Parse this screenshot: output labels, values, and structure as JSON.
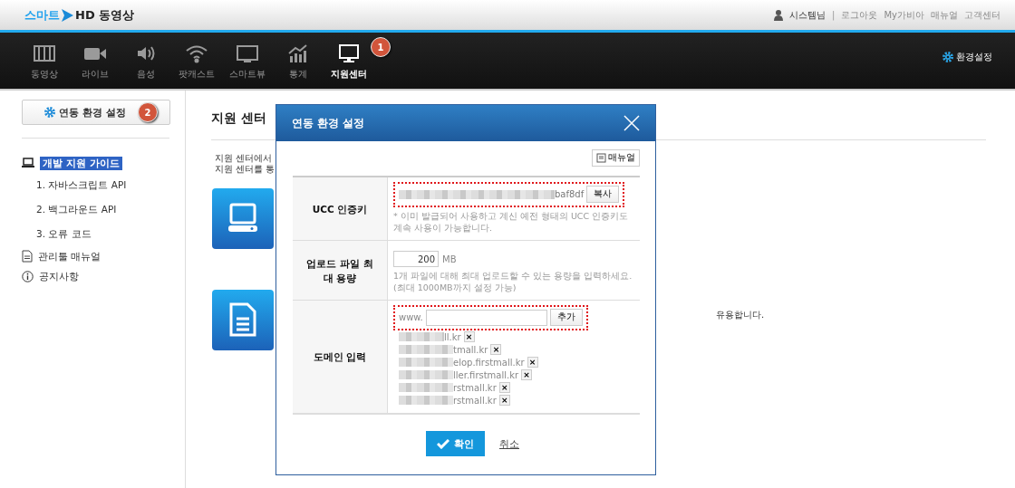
{
  "logo": {
    "part_1": "스마트",
    "part_2": "HD 동영상"
  },
  "top_links": {
    "user": "시스템님",
    "separator": "|",
    "links": [
      "로그아웃",
      "My가비아",
      "매뉴얼",
      "고객센터"
    ]
  },
  "nav": {
    "items": [
      {
        "label": "동영상",
        "selected": false
      },
      {
        "label": "라이브",
        "selected": false
      },
      {
        "label": "음성",
        "selected": false
      },
      {
        "label": "팟캐스트",
        "selected": false
      },
      {
        "label": "스마트뷰",
        "selected": false
      },
      {
        "label": "통계",
        "selected": false
      },
      {
        "label": "지원센터",
        "selected": true,
        "badge": "1"
      }
    ],
    "settings": "환경설정"
  },
  "sidebar": {
    "button": "연동 환경 설정",
    "badge": "2",
    "items": [
      {
        "label": "개발 지원 가이드",
        "selected": true,
        "children": [
          {
            "label": "1.  자바스크립트 API"
          },
          {
            "label": "2.  백그라운드 API"
          },
          {
            "label": "3.  오류 코드"
          }
        ]
      },
      {
        "label": "관리툴 매뉴얼",
        "selected": false
      },
      {
        "label": "공지사항",
        "selected": false
      }
    ]
  },
  "content": {
    "title": "지원 센터",
    "lines": [
      "지원 센터에서",
      "지원 센터를 통"
    ],
    "card_text": "유용합니다."
  },
  "dialog": {
    "title": "연동 환경 설정",
    "manual_button": "매뉴얼",
    "ucc": {
      "label": "UCC 인증키",
      "key": "baf8df",
      "copy_button": "복사",
      "note": "* 이미 발급되어 사용하고 계신 예전 형태의 UCC 인증키도 계속 사용이 가능합니다."
    },
    "upload": {
      "label": "업로드 파일 최대 용량",
      "value": "200",
      "unit": "MB",
      "note": "1개 파일에 대해 최대 업로드할 수 있는 용량을 입력하세요. (최대 1000MB까지 설정 가능)"
    },
    "domain": {
      "label": "도메인 입력",
      "prefix": "www.",
      "add_button": "추가",
      "domains": [
        "ll.kr",
        "tmall.kr",
        "elop.firstmall.kr",
        "ller.firstmall.kr",
        "rstmall.kr",
        "rstmall.kr"
      ],
      "remove": "×"
    },
    "confirm": "확인",
    "cancel": "취소"
  }
}
